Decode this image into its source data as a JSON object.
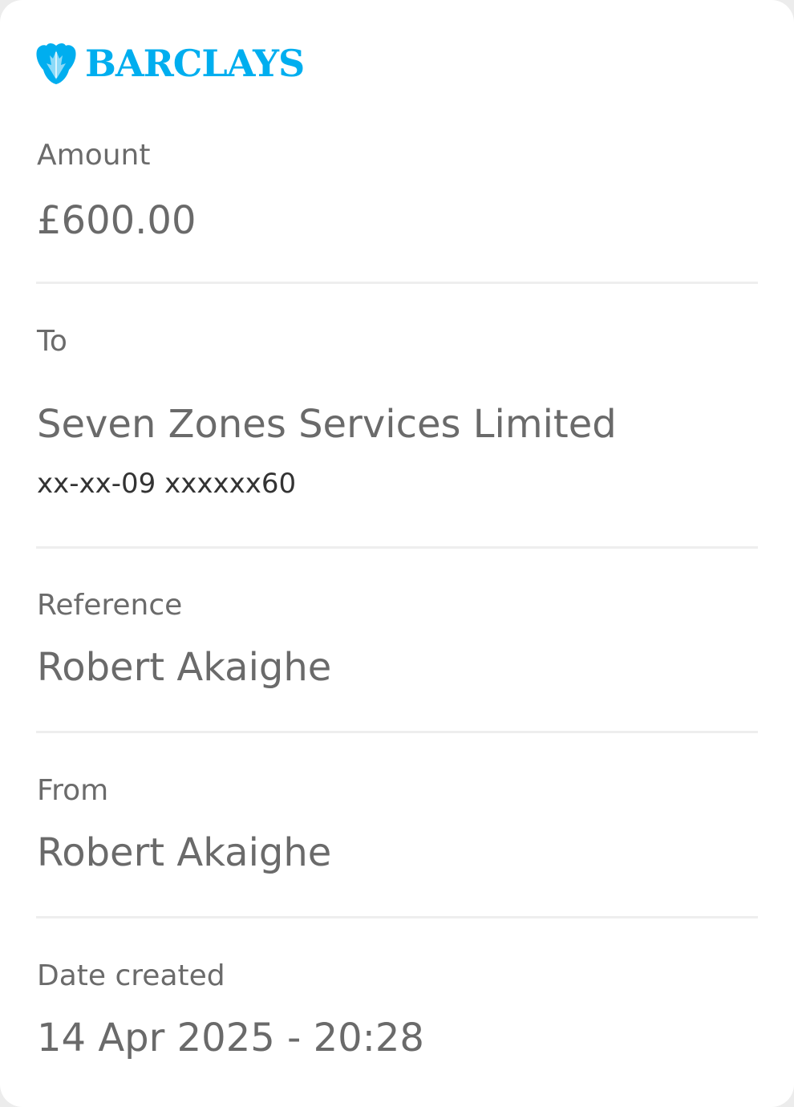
{
  "brand": {
    "name": "BARCLAYS",
    "icon": "eagle-logo-icon",
    "color": "#00aeef"
  },
  "details": {
    "amount": {
      "label": "Amount",
      "value": "£600.00"
    },
    "to": {
      "label": "To",
      "value": "Seven Zones Services Limited",
      "account": "xx-xx-09 xxxxxx60"
    },
    "reference": {
      "label": "Reference",
      "value": "Robert Akaighe"
    },
    "from": {
      "label": "From",
      "value": "Robert Akaighe"
    },
    "date_created": {
      "label": "Date created",
      "value": "14 Apr 2025 - 20:28"
    }
  }
}
